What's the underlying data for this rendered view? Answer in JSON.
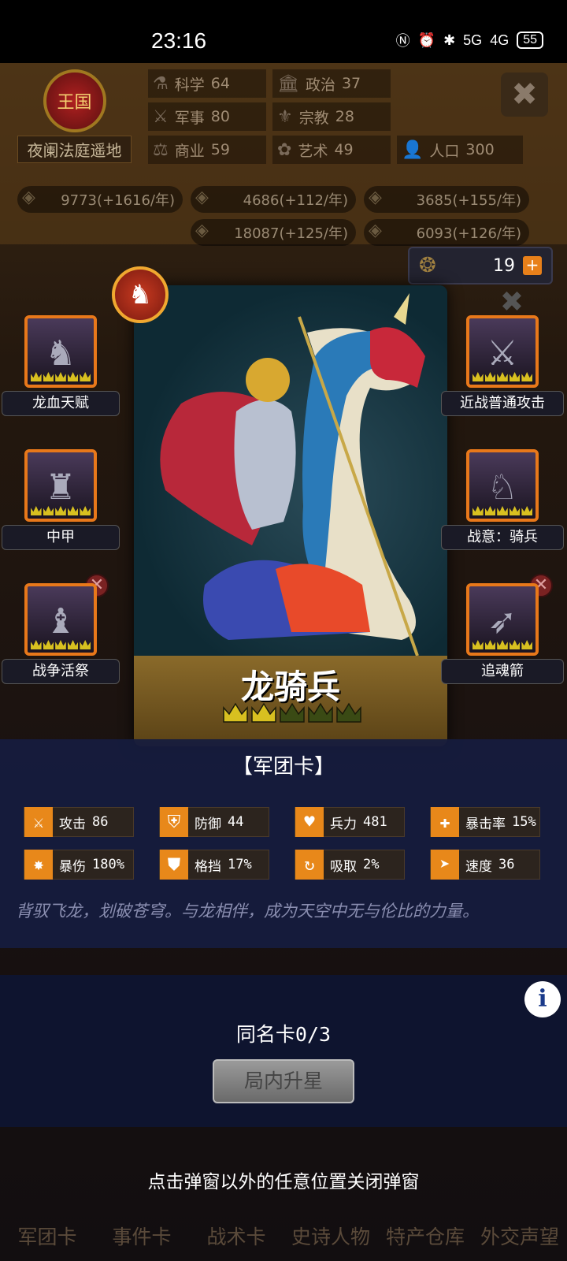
{
  "status": {
    "time": "23:16",
    "signal1": "5G",
    "signal2": "4G",
    "battery": "55"
  },
  "kingdom": {
    "crest_label": "王国",
    "name": "夜阑法庭遥地"
  },
  "stats": [
    {
      "label": "科学",
      "value": "64",
      "icon": "flask-icon"
    },
    {
      "label": "政治",
      "value": "37",
      "icon": "capitol-icon"
    },
    {
      "label": "",
      "value": "",
      "icon": ""
    },
    {
      "label": "军事",
      "value": "80",
      "icon": "crossed-swords-icon"
    },
    {
      "label": "宗教",
      "value": "28",
      "icon": "fleur-icon"
    },
    {
      "label": "",
      "value": "",
      "icon": ""
    },
    {
      "label": "商业",
      "value": "59",
      "icon": "scales-icon"
    },
    {
      "label": "艺术",
      "value": "49",
      "icon": "art-icon"
    },
    {
      "label": "人口",
      "value": "300",
      "icon": "person-icon"
    }
  ],
  "resources": [
    "9773(+1616/年)",
    "4686(+112/年)",
    "3685(+155/年)",
    "",
    "18087(+125/年)",
    "6093(+126/年)"
  ],
  "medal": {
    "count": "19",
    "plus": "+"
  },
  "card": {
    "name": "龙骑兵",
    "stars_filled": 2,
    "stars_total": 5
  },
  "skills": {
    "left": [
      {
        "label": "龙血天赋",
        "removable": false
      },
      {
        "label": "中甲",
        "removable": false
      },
      {
        "label": "战争活祭",
        "removable": true
      }
    ],
    "right": [
      {
        "label": "近战普通攻击",
        "removable": false
      },
      {
        "label": "战意：骑兵",
        "removable": false
      },
      {
        "label": "追魂箭",
        "removable": true
      }
    ]
  },
  "panel": {
    "title": "【军团卡】",
    "attributes": [
      {
        "label": "攻击",
        "value": "86",
        "icon": "sword-icon"
      },
      {
        "label": "防御",
        "value": "44",
        "icon": "shield-icon"
      },
      {
        "label": "兵力",
        "value": "481",
        "icon": "heart-icon"
      },
      {
        "label": "暴击率",
        "value": "15%",
        "icon": "crosshair-icon"
      },
      {
        "label": "暴伤",
        "value": "180%",
        "icon": "burst-icon"
      },
      {
        "label": "格挡",
        "value": "17%",
        "icon": "block-icon"
      },
      {
        "label": "吸取",
        "value": "2%",
        "icon": "drain-icon"
      },
      {
        "label": "速度",
        "value": "36",
        "icon": "boot-icon"
      }
    ],
    "description": "背驭飞龙，划破苍穹。与龙相伴，成为天空中无与伦比的力量。",
    "same_card": "同名卡0/3",
    "upstar_button": "局内升星",
    "info": "i"
  },
  "hint": "点击弹窗以外的任意位置关闭弹窗",
  "bottom_tabs": [
    "军团卡",
    "事件卡",
    "战术卡",
    "史诗人物",
    "特产仓库",
    "外交声望"
  ],
  "colors": {
    "accent_orange": "#e8881a",
    "panel_blue": "#161c3e",
    "crown_gold": "#d8c020"
  }
}
